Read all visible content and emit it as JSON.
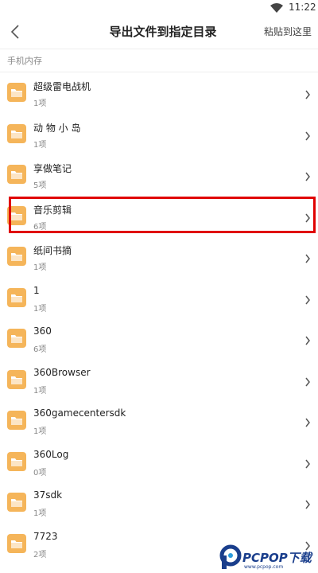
{
  "status_bar": {
    "time": "11:22",
    "wifi_icon": "wifi-icon"
  },
  "header": {
    "back_icon": "chevron-left-icon",
    "title": "导出文件到指定目录",
    "action_label": "粘贴到这里"
  },
  "section": {
    "label": "手机内存"
  },
  "folders": [
    {
      "name": "超级雷电战机",
      "count": "1项"
    },
    {
      "name": "动 物 小 岛",
      "count": "1项"
    },
    {
      "name": "享做笔记",
      "count": "5项"
    },
    {
      "name": "音乐剪辑",
      "count": "6项",
      "highlighted": true
    },
    {
      "name": "纸间书摘",
      "count": "1项"
    },
    {
      "name": "1",
      "count": "1项"
    },
    {
      "name": "360",
      "count": "6项"
    },
    {
      "name": "360Browser",
      "count": "1项"
    },
    {
      "name": "360gamecentersdk",
      "count": "1项"
    },
    {
      "name": "360Log",
      "count": "0项"
    },
    {
      "name": "37sdk",
      "count": "1项"
    },
    {
      "name": "7723",
      "count": "2项"
    }
  ],
  "colors": {
    "folder": "#f5b55a",
    "highlight_border": "#e00000",
    "watermark": "#1a3e8c"
  },
  "watermark": {
    "text": "PCPOP下载",
    "subtext": "www.pcpop.com"
  }
}
